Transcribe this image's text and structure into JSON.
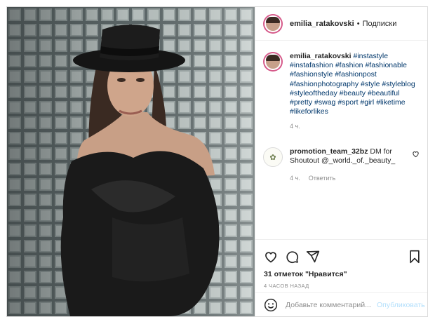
{
  "post": {
    "username": "emilia_ratakovski",
    "separator": "•",
    "follow_label": "Подписки",
    "caption_username": "emilia_ratakovski",
    "hashtags": [
      "#instastyle",
      "#instafashion",
      "#fashion",
      "#fashionable",
      "#fashionstyle",
      "#fashionpost",
      "#fashionphotography",
      "#style",
      "#styleblog",
      "#styleoftheday",
      "#beauty",
      "#beautiful",
      "#pretty",
      "#swag",
      "#sport",
      "#girl",
      "#liketime",
      "#likeforlikes"
    ],
    "caption_time": "4 ч."
  },
  "comment": {
    "username": "promotion_team_32bz",
    "text": "DM for Shoutout @_world._of._beauty_",
    "time": "4 ч.",
    "reply_label": "Ответить"
  },
  "actions": {
    "likes_text": "31 отметок \"Нравится\"",
    "time_ago": "4 ЧАСОВ НАЗАД",
    "comment_placeholder": "Добавьте комментарий...",
    "post_label": "Опубликовать"
  },
  "icons": [
    "heart-icon",
    "comment-icon",
    "share-icon",
    "bookmark-icon",
    "emoji-icon",
    "heart-small-icon"
  ],
  "colors": {
    "link": "#00376b",
    "muted": "#8e8e8e",
    "post_disabled": "#b2dffc"
  }
}
